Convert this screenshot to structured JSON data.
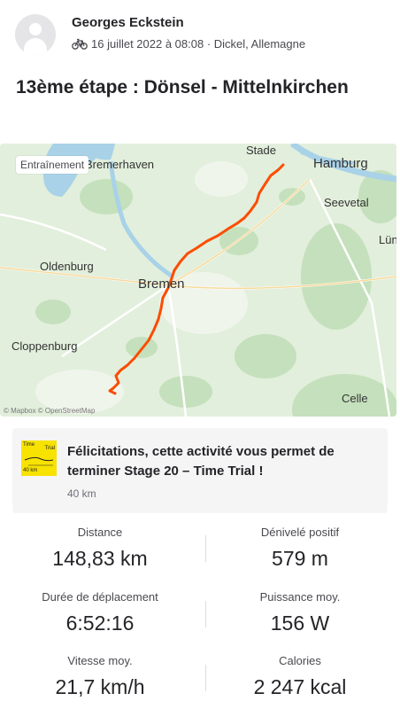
{
  "activity": {
    "athlete_name": "Georges Eckstein",
    "sport_icon": "bike-icon",
    "date_location": "16 juillet 2022 à 08:08 · Dickel, Allemagne",
    "title": "13ème étape : Dönsel - Mittelnkirchen"
  },
  "map": {
    "tag": "Entraînement",
    "route_color": "#fc4c02",
    "attribution": "© Mapbox © OpenStreetMap",
    "places": [
      "Stade",
      "Hamburg",
      "Bremerhaven",
      "Seevetal",
      "Lün",
      "Oldenburg",
      "Bremen",
      "Cloppenburg",
      "Celle"
    ]
  },
  "achievement": {
    "icon": "time-trial-badge-icon",
    "icon_labels": [
      "Time",
      "Trial",
      "40 km"
    ],
    "text": "Félicitations, cette activité vous permet de terminer Stage 20 – Time Trial !",
    "subtext": "40 km",
    "badge_color": "#f7e200"
  },
  "stats": [
    {
      "label": "Distance",
      "value": "148,83 km"
    },
    {
      "label": "Dénivelé positif",
      "value": "579 m"
    },
    {
      "label": "Durée de déplacement",
      "value": "6:52:16"
    },
    {
      "label": "Puissance moy.",
      "value": "156 W"
    },
    {
      "label": "Vitesse moy.",
      "value": "21,7 km/h"
    },
    {
      "label": "Calories",
      "value": "2 247 kcal"
    }
  ]
}
